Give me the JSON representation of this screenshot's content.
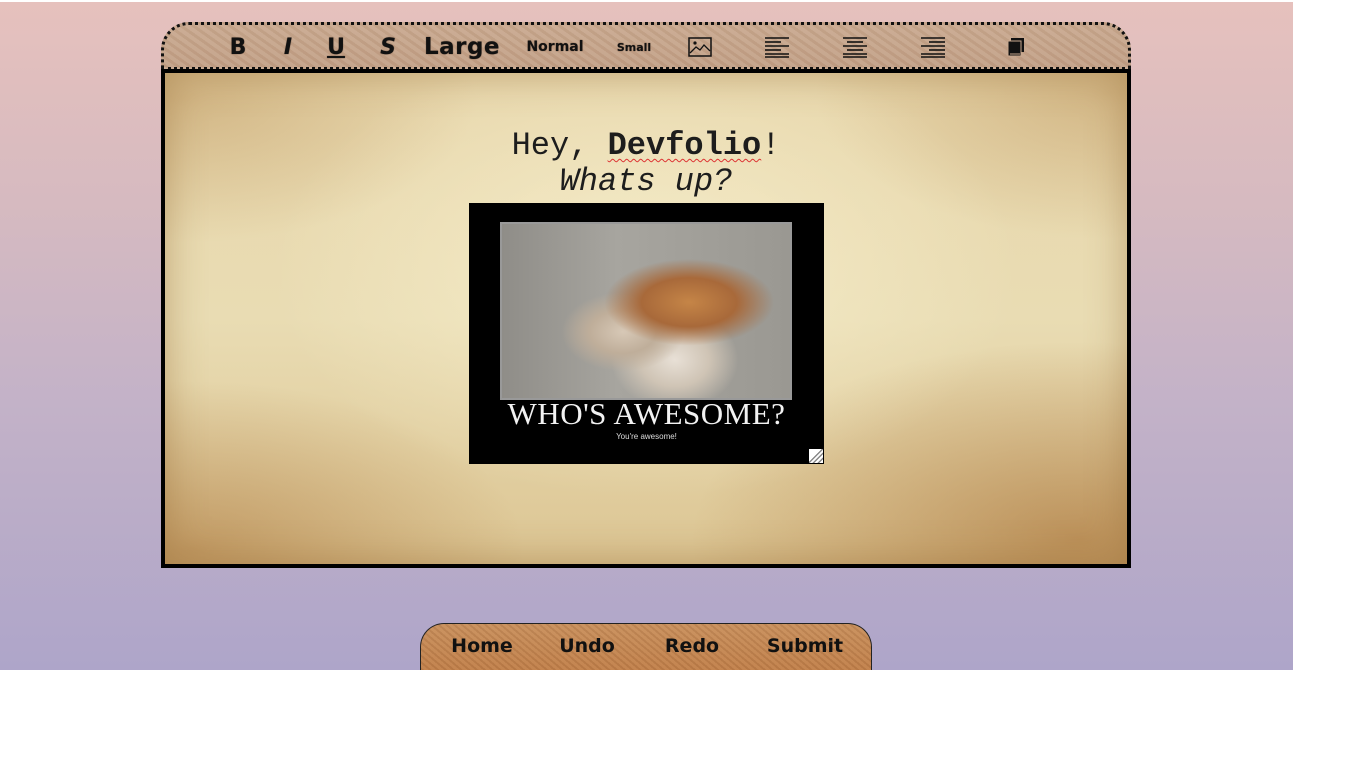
{
  "toolbar": {
    "bold_label": "B",
    "italic_label": "I",
    "underline_label": "U",
    "strike_label": "S",
    "large_label": "Large",
    "normal_label": "Normal",
    "small_label": "Small",
    "icons": [
      "image-icon",
      "align-left-icon",
      "align-center-icon",
      "align-right-icon",
      "save-icon"
    ]
  },
  "editor": {
    "greeting_prefix": "Hey, ",
    "greeting_name": "Devfolio",
    "greeting_suffix": "!",
    "subline": "Whats up?",
    "meme": {
      "caption": "WHO'S AWESOME?",
      "subcaption": "You're awesome!"
    }
  },
  "nav": {
    "home": "Home",
    "undo": "Undo",
    "redo": "Redo",
    "submit": "Submit"
  },
  "colors": {
    "page_gradient_top": "#e6c1bd",
    "page_gradient_bottom": "#aea5c9",
    "toolbar_bg": "#c9a98f",
    "paper_bg": "#e9dcb3",
    "nav_bg": "#c88f5c"
  }
}
